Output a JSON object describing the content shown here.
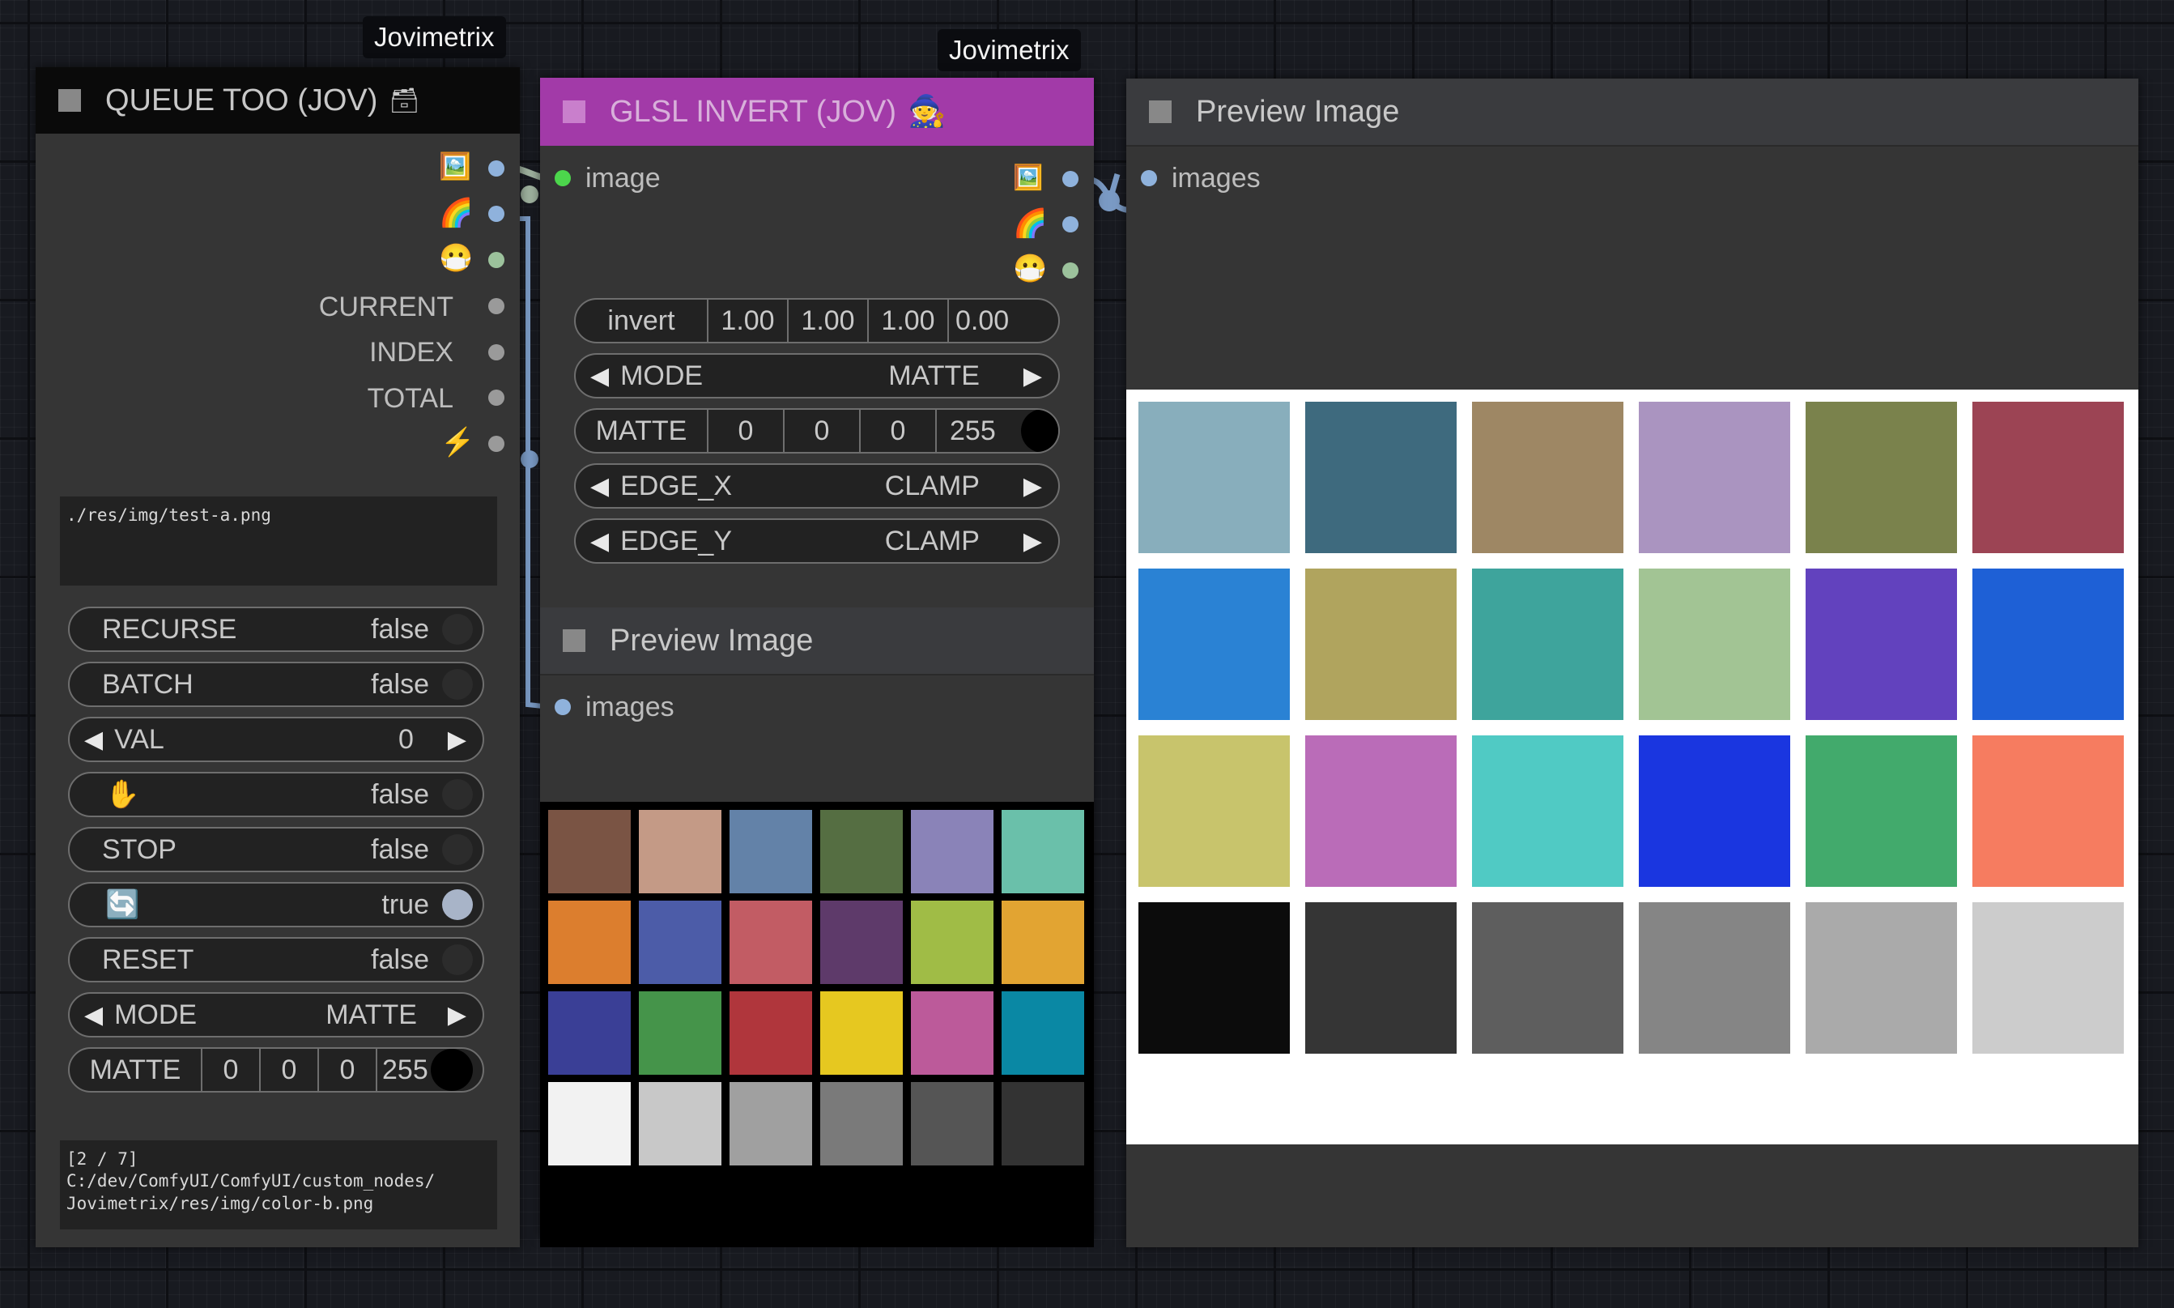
{
  "badges": [
    "Jovimetrix",
    "Jovimetrix"
  ],
  "queue_node": {
    "title": "QUEUE TOO (JOV)",
    "title_emoji": "🗃",
    "outputs": [
      {
        "icon": "🖼️",
        "label": "",
        "icon_name": "image-icon",
        "color": "#8fb2dc"
      },
      {
        "icon": "🌈",
        "label": "",
        "icon_name": "rainbow-icon",
        "color": "#8fb2dc"
      },
      {
        "icon": "😷",
        "label": "",
        "icon_name": "mask-face-icon",
        "color": "#9cc29c"
      },
      {
        "icon": "",
        "label": "CURRENT",
        "icon_name": "",
        "color": "#9a9a9a"
      },
      {
        "icon": "",
        "label": "INDEX",
        "icon_name": "",
        "color": "#9a9a9a"
      },
      {
        "icon": "",
        "label": "TOTAL",
        "icon_name": "",
        "color": "#9a9a9a"
      },
      {
        "icon": "⚡",
        "label": "",
        "icon_name": "lightning-icon",
        "color": "#9a9a9a"
      }
    ],
    "path_text": "./res/img/test-a.png",
    "widgets": {
      "recurse": {
        "label": "RECURSE",
        "value": "false"
      },
      "batch": {
        "label": "BATCH",
        "value": "false"
      },
      "val": {
        "label": "VAL",
        "value": "0"
      },
      "hand": {
        "icon": "✋",
        "value": "false"
      },
      "stop": {
        "label": "STOP",
        "value": "false"
      },
      "loop": {
        "icon": "🔄",
        "value": "true"
      },
      "reset": {
        "label": "RESET",
        "value": "false"
      },
      "mode": {
        "label": "MODE",
        "value": "MATTE"
      },
      "matte": {
        "label": "MATTE",
        "values": [
          "0",
          "0",
          "0",
          "255"
        ]
      }
    },
    "status_text": "[2 / 7]\nC:/dev/ComfyUI/ComfyUI/custom_nodes/\nJovimetrix/res/img/color-b.png"
  },
  "glsl_node": {
    "title": "GLSL INVERT (JOV)",
    "title_emoji": "🧙",
    "input_label": "image",
    "outputs": [
      {
        "icon": "🖼️",
        "icon_name": "image-icon",
        "color": "#8fb2dc"
      },
      {
        "icon": "🌈",
        "icon_name": "rainbow-icon",
        "color": "#8fb2dc"
      },
      {
        "icon": "😷",
        "icon_name": "mask-face-icon",
        "color": "#9cc29c"
      }
    ],
    "invert": {
      "label": "invert",
      "values": [
        "1.00",
        "1.00",
        "1.00",
        "0.00"
      ]
    },
    "mode": {
      "label": "MODE",
      "value": "MATTE"
    },
    "matte": {
      "label": "MATTE",
      "values": [
        "0",
        "0",
        "0",
        "255"
      ]
    },
    "edge_x": {
      "label": "EDGE_X",
      "value": "CLAMP"
    },
    "edge_y": {
      "label": "EDGE_Y",
      "value": "CLAMP"
    },
    "preview_title": "Preview Image",
    "preview_input": "images",
    "preview_colors": [
      "#7a5444",
      "#c49a86",
      "#6382a8",
      "#556e42",
      "#8a83b8",
      "#6ac0aa",
      "#dc7e2e",
      "#4c5ca8",
      "#c25c64",
      "#5e3a6a",
      "#a0bc46",
      "#e2a432",
      "#3a3f96",
      "#45944a",
      "#b0363c",
      "#e6c820",
      "#bc5a9a",
      "#0a88a4",
      "#f2f2f2",
      "#c8c8c8",
      "#a0a0a0",
      "#7a7a7a",
      "#555555",
      "#333333"
    ]
  },
  "preview_node": {
    "title": "Preview Image",
    "input_label": "images",
    "colors": [
      "#88aebc",
      "#3e6a7e",
      "#9e8764",
      "#aa94c0",
      "#7a824c",
      "#9c4454",
      "#2a82d4",
      "#b0a45e",
      "#3ea49c",
      "#a2c494",
      "#6242be",
      "#1e60d6",
      "#c8c46c",
      "#ba6cb8",
      "#50cac4",
      "#1a36e0",
      "#42aa6c",
      "#f67c60",
      "#0c0c0c",
      "#353535",
      "#5e5e5e",
      "#858585",
      "#aaaaaa",
      "#cccccc"
    ]
  }
}
